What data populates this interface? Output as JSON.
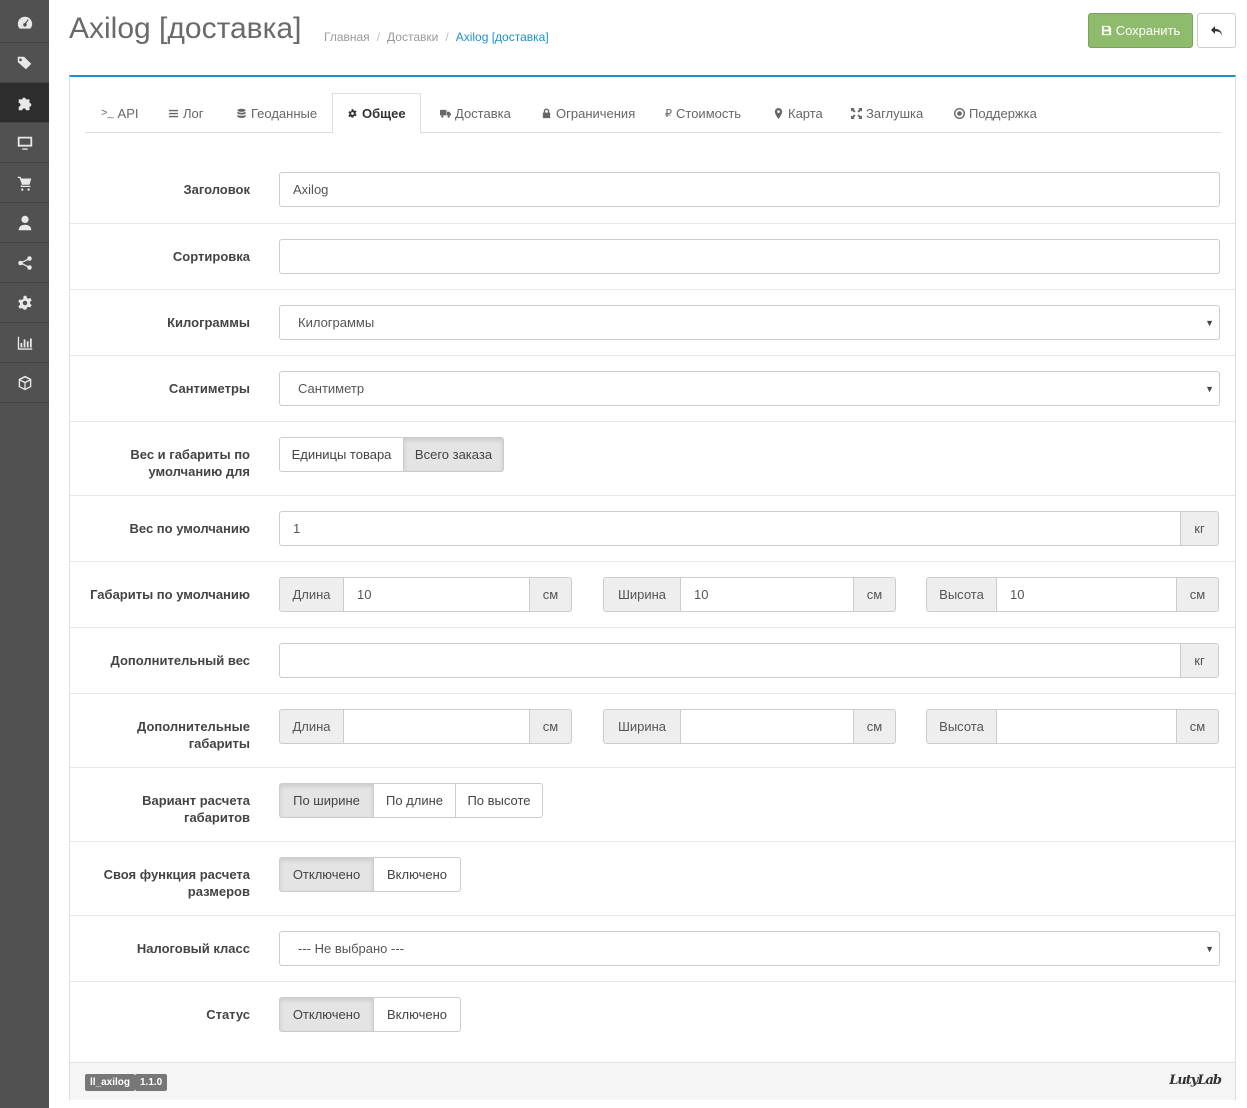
{
  "sidebar": {
    "items": [
      {
        "icon": "dashboard-icon"
      },
      {
        "icon": "tags-icon"
      },
      {
        "icon": "puzzle-icon",
        "active": true
      },
      {
        "icon": "desktop-icon"
      },
      {
        "icon": "cart-icon"
      },
      {
        "icon": "user-icon"
      },
      {
        "icon": "share-icon"
      },
      {
        "icon": "gear-icon"
      },
      {
        "icon": "bar-chart-icon"
      },
      {
        "icon": "cube-icon"
      }
    ]
  },
  "header": {
    "title": "Axilog [доставка]",
    "breadcrumb": [
      "Главная",
      "Доставки",
      "Axilog [доставка]"
    ],
    "save_label": "Сохранить",
    "colors": {
      "accent": "#1e91cf",
      "save": "#8fbb6c"
    }
  },
  "tabs": [
    {
      "label": "API",
      "icon": "terminal-icon"
    },
    {
      "label": "Лог",
      "icon": "list-icon"
    },
    {
      "label": "Геоданные",
      "icon": "database-icon"
    },
    {
      "label": "Общее",
      "icon": "cog-icon",
      "active": true
    },
    {
      "label": "Доставка",
      "icon": "truck-icon"
    },
    {
      "label": "Ограничения",
      "icon": "lock-icon"
    },
    {
      "label": "Стоимость",
      "icon": "ruble-icon"
    },
    {
      "label": "Карта",
      "icon": "map-marker-icon"
    },
    {
      "label": "Заглушка",
      "icon": "expand-icon"
    },
    {
      "label": "Поддержка",
      "icon": "life-ring-icon"
    }
  ],
  "form": {
    "title": {
      "label": "Заголовок",
      "value": "Axilog"
    },
    "sort": {
      "label": "Сортировка",
      "value": ""
    },
    "weight_unit": {
      "label": "Килограммы",
      "value": "Килограммы"
    },
    "length_unit": {
      "label": "Сантиметры",
      "value": "Сантиметр"
    },
    "defaults_for": {
      "label": "Вес и габариты по умолчанию для",
      "options": [
        "Единицы товара",
        "Всего заказа"
      ],
      "selected": 1
    },
    "default_weight": {
      "label": "Вес по умолчанию",
      "value": "1",
      "unit": "кг"
    },
    "default_dims": {
      "label": "Габариты по умолчанию",
      "length_label": "Длина",
      "length": "10",
      "width_label": "Ширина",
      "width": "10",
      "height_label": "Высота",
      "height": "10",
      "unit": "см"
    },
    "extra_weight": {
      "label": "Дополнительный вес",
      "value": "",
      "unit": "кг"
    },
    "extra_dims": {
      "label": "Дополнительные габариты",
      "length_label": "Длина",
      "length": "",
      "width_label": "Ширина",
      "width": "",
      "height_label": "Высота",
      "height": "",
      "unit": "см"
    },
    "calc_variant": {
      "label": "Вариант расчета габаритов",
      "options": [
        "По ширине",
        "По длине",
        "По высоте"
      ],
      "selected": 0
    },
    "custom_func": {
      "label": "Своя функция расчета размеров",
      "options": [
        "Отключено",
        "Включено"
      ],
      "selected": 0
    },
    "tax_class": {
      "label": "Налоговый класс",
      "value": "--- Не выбрано ---"
    },
    "status": {
      "label": "Статус",
      "options": [
        "Отключено",
        "Включено"
      ],
      "selected": 0
    }
  },
  "footer": {
    "module": "ll_axilog",
    "version": "1.1.0",
    "logo": "LutyLab"
  }
}
